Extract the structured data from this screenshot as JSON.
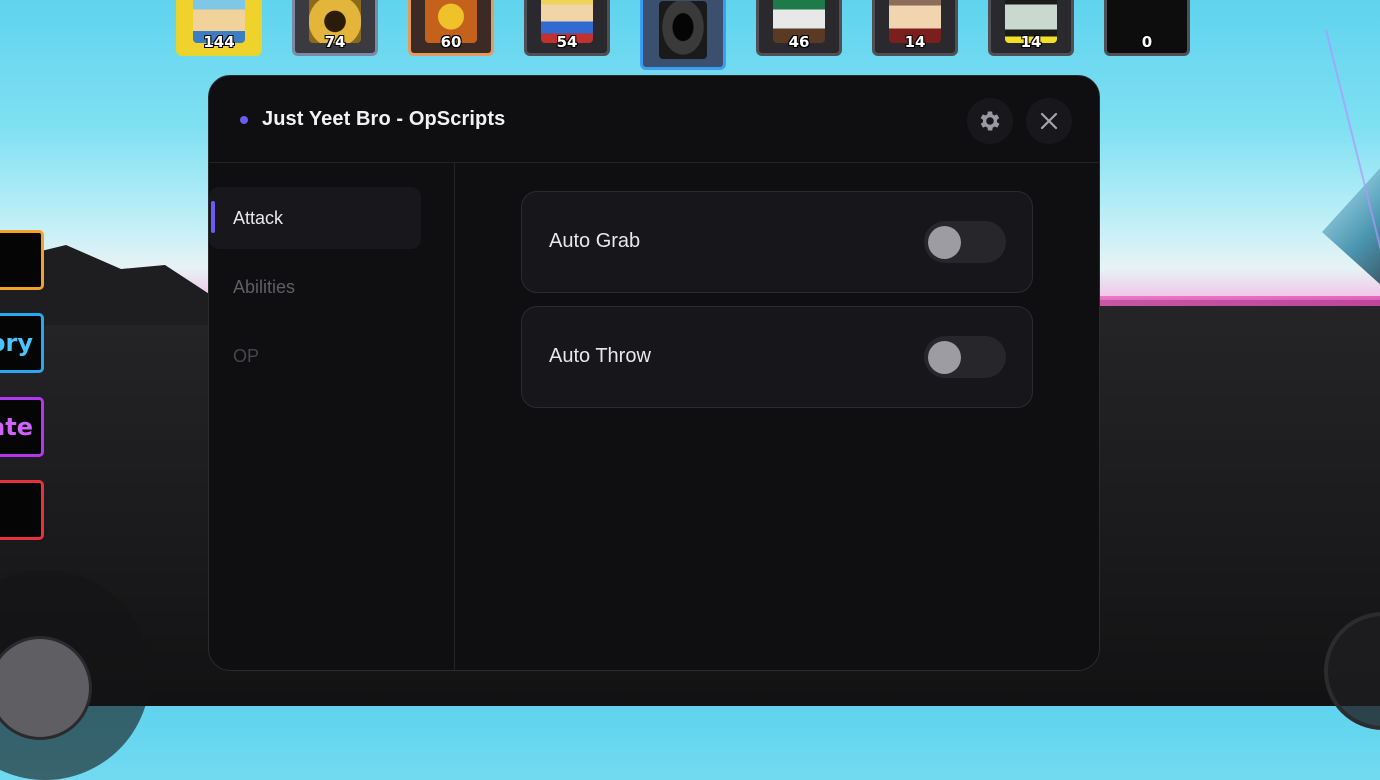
{
  "players": [
    {
      "count": "144",
      "avatar": "player-avatar-1"
    },
    {
      "count": "74",
      "avatar": "player-avatar-2"
    },
    {
      "count": "60",
      "avatar": "player-avatar-3"
    },
    {
      "count": "54",
      "avatar": "player-avatar-4"
    },
    {
      "count": "",
      "avatar": "player-avatar-5-hooded"
    },
    {
      "count": "46",
      "avatar": "player-avatar-6"
    },
    {
      "count": "14",
      "avatar": "player-avatar-7"
    },
    {
      "count": "14",
      "avatar": "player-avatar-8"
    },
    {
      "count": "0",
      "avatar": "player-avatar-9"
    }
  ],
  "side_buttons": [
    {
      "label": "",
      "color": "#f2a12a"
    },
    {
      "label": "ory",
      "color": "#2aa7f2"
    },
    {
      "label": "ate",
      "color": "#b237f0"
    },
    {
      "label": "",
      "color": "#e5323b"
    }
  ],
  "panel": {
    "title": "Just Yeet Bro - OpScripts",
    "accent_color": "#6a5cf0",
    "settings_icon": "gear-icon",
    "close_icon": "close-icon"
  },
  "sidebar": {
    "items": [
      {
        "label": "Attack",
        "active": true
      },
      {
        "label": "Abilities",
        "active": false
      },
      {
        "label": "OP",
        "active": false
      }
    ]
  },
  "toggles": [
    {
      "label": "Auto Grab",
      "enabled": false
    },
    {
      "label": "Auto Throw",
      "enabled": false
    }
  ]
}
